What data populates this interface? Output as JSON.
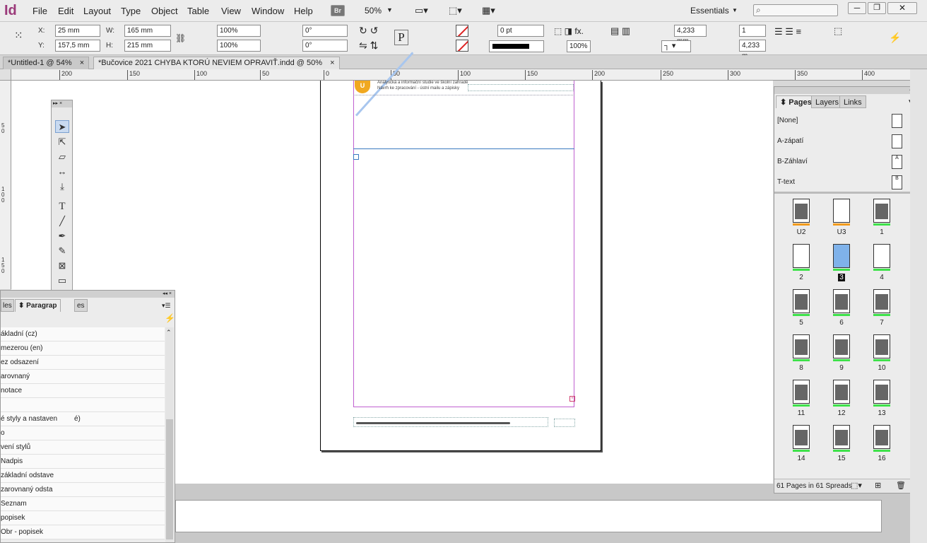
{
  "app": {
    "logo": "Id"
  },
  "menu": [
    "File",
    "Edit",
    "Layout",
    "Type",
    "Object",
    "Table",
    "View",
    "Window",
    "Help"
  ],
  "topbar": {
    "bridge": "Br",
    "zoom": "50%",
    "workspace": "Essentials",
    "search_placeholder": ""
  },
  "control": {
    "x": "25 mm",
    "y": "157,5 mm",
    "w": "165 mm",
    "h": "215 mm",
    "sx": "100%",
    "sy": "100%",
    "rot": "0°",
    "shear": "0°",
    "stroke_w": "0 pt",
    "opacity": "100%",
    "fit1": "4,233 mm",
    "fit2": "4,233 m",
    "cols": "1",
    "x_label": "X:",
    "y_label": "Y:",
    "w_label": "W:",
    "h_label": "H:",
    "p_label": "P"
  },
  "tabs": [
    {
      "label": "*Untitled-1 @ 54%"
    },
    {
      "label": "*Bučovice 2021 CHYBA KTORÚ NEVIEM OPRAVIŤ.indd @ 50%"
    }
  ],
  "hruler": [
    "200",
    "150",
    "100",
    "50",
    "0",
    "50",
    "100",
    "150",
    "200",
    "250",
    "300",
    "350",
    "400"
  ],
  "vruler": [
    "5 0",
    "1 0 0",
    "1 5 0"
  ],
  "page_text": {
    "line1": "Analytická a informační studie ve školní zahradě",
    "line2": "Návrh ke zpracování - ústní mailu a zápisky",
    "marker": "U"
  },
  "para_panel": {
    "tab_prefix": "les",
    "tab_label": "Paragrap",
    "tab_suffix": "es",
    "items": [
      "ákladní (cz)",
      "mezerou (en)",
      "ez odsazení",
      "arovnaný",
      "notace",
      "",
      "é styly a nastaven",
      "o",
      "vení stylů",
      "Nadpis",
      "základní odstave",
      "zarovnaný odsta",
      "Seznam",
      "popisek",
      "Obr - popisek"
    ],
    "suffix_item": "é)"
  },
  "pages_panel": {
    "tabs": [
      "Pages",
      "Layers",
      "Links"
    ],
    "masters": [
      {
        "label": "[None]",
        "letter": ""
      },
      {
        "label": "A-zápatí",
        "letter": ""
      },
      {
        "label": "B-Záhlaví",
        "letter": "A"
      },
      {
        "label": "T-text",
        "letter": "B"
      }
    ],
    "pages": [
      "U2",
      "U3",
      "1",
      "2",
      "3",
      "4",
      "5",
      "6",
      "7",
      "8",
      "9",
      "10",
      "11",
      "12",
      "13",
      "14",
      "15",
      "16"
    ],
    "footer": "61 Pages in 61 Spreads"
  },
  "colors": {
    "accent": "#9b3a7a",
    "selected_page": "#7fb2ea",
    "margin": "#c060d0"
  }
}
